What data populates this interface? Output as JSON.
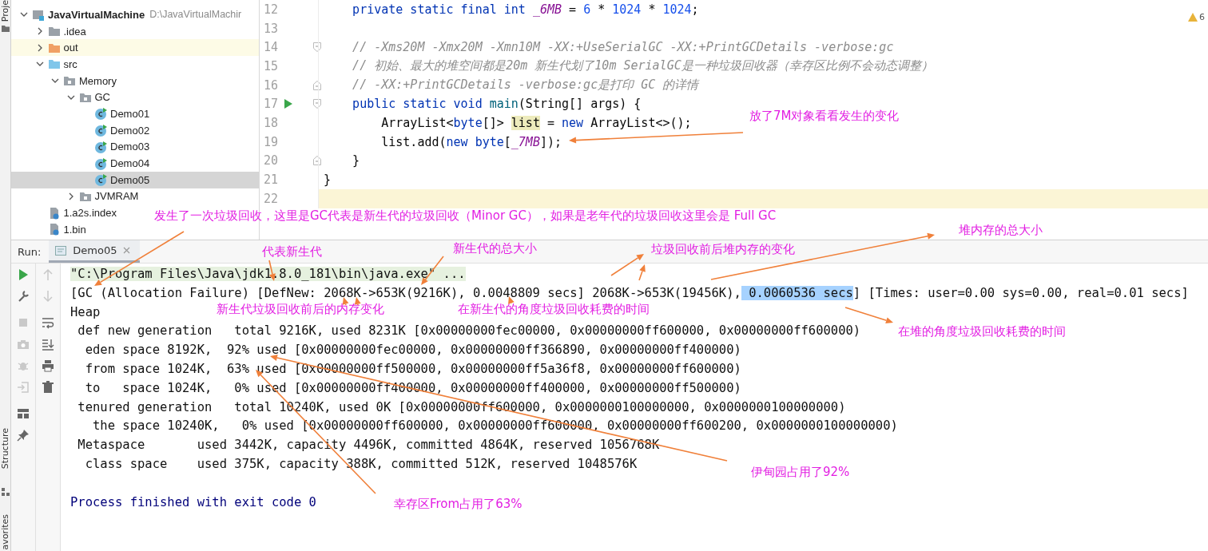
{
  "left_stripe": {
    "top_tabs": [
      "Proje"
    ],
    "bottom_tabs": [
      "Structure",
      "avorites"
    ]
  },
  "project_tree": [
    {
      "kind": "module",
      "label": "JavaVirtualMachine",
      "path": "D:\\JavaVirtualMachir",
      "expanded": true,
      "selected": false,
      "children": [
        {
          "kind": "folder",
          "label": ".idea",
          "expanded": false,
          "selected": false
        },
        {
          "kind": "excluded-folder",
          "label": "out",
          "expanded": false,
          "selected": false
        },
        {
          "kind": "source-folder",
          "label": "src",
          "expanded": true,
          "selected": false,
          "children": [
            {
              "kind": "package",
              "label": "Memory",
              "expanded": true,
              "selected": false,
              "children": [
                {
                  "kind": "package",
                  "label": "GC",
                  "expanded": true,
                  "selected": false,
                  "children": [
                    {
                      "kind": "class",
                      "label": "Demo01",
                      "selected": false
                    },
                    {
                      "kind": "class",
                      "label": "Demo02",
                      "selected": false
                    },
                    {
                      "kind": "class",
                      "label": "Demo03",
                      "selected": false
                    },
                    {
                      "kind": "class",
                      "label": "Demo04",
                      "selected": false
                    },
                    {
                      "kind": "class",
                      "label": "Demo05",
                      "selected": true
                    }
                  ]
                },
                {
                  "kind": "package",
                  "label": "JVMRAM",
                  "expanded": false,
                  "selected": false
                }
              ]
            }
          ]
        },
        {
          "kind": "file",
          "label": "1.a2s.index",
          "selected": false
        },
        {
          "kind": "file",
          "label": "1.bin",
          "selected": false
        }
      ]
    }
  ],
  "editor": {
    "inspection_count": "6",
    "lines": [
      {
        "number": "12",
        "current": false,
        "tokens": [
          {
            "kind": "keyword",
            "text": "    private static final int "
          },
          {
            "kind": "constant",
            "text": "_6MB"
          },
          {
            "kind": "plain",
            "text": " = "
          },
          {
            "kind": "number",
            "text": "6"
          },
          {
            "kind": "plain",
            "text": " * "
          },
          {
            "kind": "number",
            "text": "1024"
          },
          {
            "kind": "plain",
            "text": " * "
          },
          {
            "kind": "number",
            "text": "1024"
          },
          {
            "kind": "plain",
            "text": ";"
          }
        ]
      },
      {
        "number": "13",
        "current": false
      },
      {
        "number": "14",
        "current": false,
        "fold_start": true,
        "tokens": [
          {
            "kind": "comment",
            "text": "    // -Xms20M -Xmx20M -Xmn10M -XX:+UseSerialGC -XX:+PrintGCDetails -verbose:gc"
          }
        ]
      },
      {
        "number": "15",
        "current": false,
        "tokens": [
          {
            "kind": "comment",
            "text": "    // 初始、最大的堆空间都是20m 新生代划了10m SerialGC是一种垃圾回收器（幸存区比例不会动态调整）"
          }
        ]
      },
      {
        "number": "16",
        "current": false,
        "fold_end": true,
        "tokens": [
          {
            "kind": "comment",
            "text": "    // -XX:+PrintGCDetails -verbose:gc是打印 GC 的详情"
          }
        ]
      },
      {
        "number": "17",
        "current": false,
        "runnable": true,
        "fold_start": true,
        "tokens": [
          {
            "kind": "keyword",
            "text": "    public static void "
          },
          {
            "kind": "method",
            "text": "main"
          },
          {
            "kind": "plain",
            "text": "(String[] args) {"
          }
        ]
      },
      {
        "number": "18",
        "current": false,
        "tokens": [
          {
            "kind": "plain",
            "text": "        ArrayList<"
          },
          {
            "kind": "keyword",
            "text": "byte"
          },
          {
            "kind": "plain",
            "text": "[]> "
          },
          {
            "kind": "highlight",
            "text": "list"
          },
          {
            "kind": "plain",
            "text": " = "
          },
          {
            "kind": "keyword",
            "text": "new"
          },
          {
            "kind": "plain",
            "text": " ArrayList<>();"
          }
        ]
      },
      {
        "number": "19",
        "current": false,
        "tokens": [
          {
            "kind": "plain",
            "text": "        list.add("
          },
          {
            "kind": "keyword",
            "text": "new byte"
          },
          {
            "kind": "plain",
            "text": "["
          },
          {
            "kind": "constant",
            "text": "_7MB"
          },
          {
            "kind": "plain",
            "text": "]);"
          }
        ]
      },
      {
        "number": "20",
        "current": false,
        "fold_end": true,
        "tokens": [
          {
            "kind": "plain",
            "text": "    }"
          }
        ]
      },
      {
        "number": "21",
        "current": false,
        "tokens": [
          {
            "kind": "plain",
            "text": "}"
          }
        ]
      },
      {
        "number": "22",
        "current": true
      }
    ]
  },
  "run_panel": {
    "label": "Run:",
    "tabs": [
      {
        "label": "Demo05",
        "selected": true
      }
    ],
    "lines": [
      {
        "kind": "command",
        "segments": [
          {
            "text": "\"C:\\Program Files\\Java\\jdk1.8.0_181\\bin\\java.exe\" ...",
            "selected": false
          }
        ]
      },
      {
        "kind": "output",
        "segments": [
          {
            "text": "[GC (Allocation Failure) [DefNew: 2068K->653K(9216K), 0.0048809 secs] 2068K->653K(19456K),",
            "selected": false
          },
          {
            "text": " 0.0060536 secs",
            "selected": true
          },
          {
            "text": "] [Times: user=0.00 sys=0.00, real=0.01 secs]",
            "selected": false
          }
        ]
      },
      {
        "kind": "output",
        "segments": [
          {
            "text": "Heap",
            "selected": false
          }
        ]
      },
      {
        "kind": "output",
        "segments": [
          {
            "text": " def new generation   total 9216K, used 8231K [0x00000000fec00000, 0x00000000ff600000, 0x00000000ff600000)",
            "selected": false
          }
        ]
      },
      {
        "kind": "output",
        "segments": [
          {
            "text": "  eden space 8192K,  92% used [0x00000000fec00000, 0x00000000ff366890, 0x00000000ff400000)",
            "selected": false
          }
        ]
      },
      {
        "kind": "output",
        "segments": [
          {
            "text": "  from space 1024K,  63% used [0x00000000ff500000, 0x00000000ff5a36f8, 0x00000000ff600000)",
            "selected": false
          }
        ]
      },
      {
        "kind": "output",
        "segments": [
          {
            "text": "  to   space 1024K,   0% used [0x00000000ff400000, 0x00000000ff400000, 0x00000000ff500000)",
            "selected": false
          }
        ]
      },
      {
        "kind": "output",
        "segments": [
          {
            "text": " tenured generation   total 10240K, used 0K [0x00000000ff600000, 0x0000000100000000, 0x0000000100000000)",
            "selected": false
          }
        ]
      },
      {
        "kind": "output",
        "segments": [
          {
            "text": "   the space 10240K,   0% used [0x00000000ff600000, 0x00000000ff600000, 0x00000000ff600200, 0x0000000100000000)",
            "selected": false
          }
        ]
      },
      {
        "kind": "output",
        "segments": [
          {
            "text": " Metaspace       used 3442K, capacity 4496K, committed 4864K, reserved 1056768K",
            "selected": false
          }
        ]
      },
      {
        "kind": "output",
        "segments": [
          {
            "text": "  class space    used 375K, capacity 388K, committed 512K, reserved 1048576K",
            "selected": false
          }
        ]
      },
      {
        "kind": "exit",
        "segments": [
          {
            "text": "Process finished with exit code 0",
            "selected": false
          }
        ]
      }
    ]
  },
  "annotations": [
    {
      "text": "放了7M对象看看发生的变化"
    },
    {
      "text": "发生了一次垃圾回收，这里是GC代表是新生代的垃圾回收（Minor GC），如果是老年代的垃圾回收这里会是 Full GC"
    },
    {
      "text": "代表新生代"
    },
    {
      "text": "新生代的总大小"
    },
    {
      "text": "垃圾回收前后堆内存的变化"
    },
    {
      "text": "堆内存的总大小"
    },
    {
      "text": "新生代垃圾回收前后的内存变化"
    },
    {
      "text": "在新生代的角度垃圾回收耗费的时间"
    },
    {
      "text": "在堆的角度垃圾回收耗费的时间"
    },
    {
      "text": "伊甸园占用了92%"
    },
    {
      "text": "幸存区From占用了63%"
    }
  ]
}
